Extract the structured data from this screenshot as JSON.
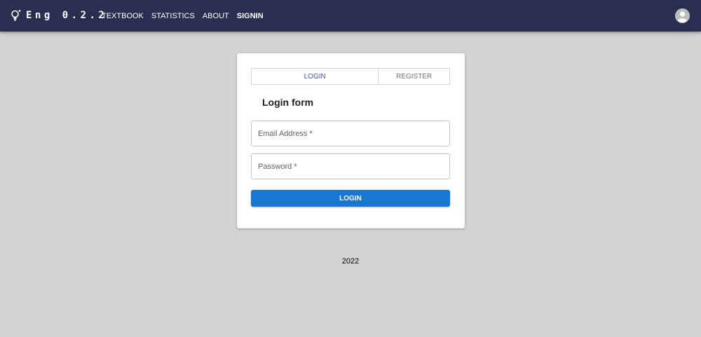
{
  "app": {
    "brand": "Eng 0.2.2",
    "accent_color": "#1976d2",
    "appbar_color": "#2a2f52",
    "logo_icon": "lightbulb-icon",
    "avatar_icon": "user-avatar-icon"
  },
  "nav": {
    "items": [
      {
        "label": "TEXTBOOK",
        "active": false
      },
      {
        "label": "STATISTICS",
        "active": false
      },
      {
        "label": "ABOUT",
        "active": false
      },
      {
        "label": "SIGNIN",
        "active": true
      }
    ]
  },
  "auth": {
    "tabs": [
      {
        "label": "LOGIN",
        "selected": true
      },
      {
        "label": "REGISTER",
        "selected": false
      }
    ],
    "form_title": "Login form",
    "email": {
      "placeholder": "Email Address *",
      "value": ""
    },
    "password": {
      "placeholder": "Password *",
      "value": ""
    },
    "submit_label": "LOGIN"
  },
  "footer": {
    "year": "2022"
  }
}
